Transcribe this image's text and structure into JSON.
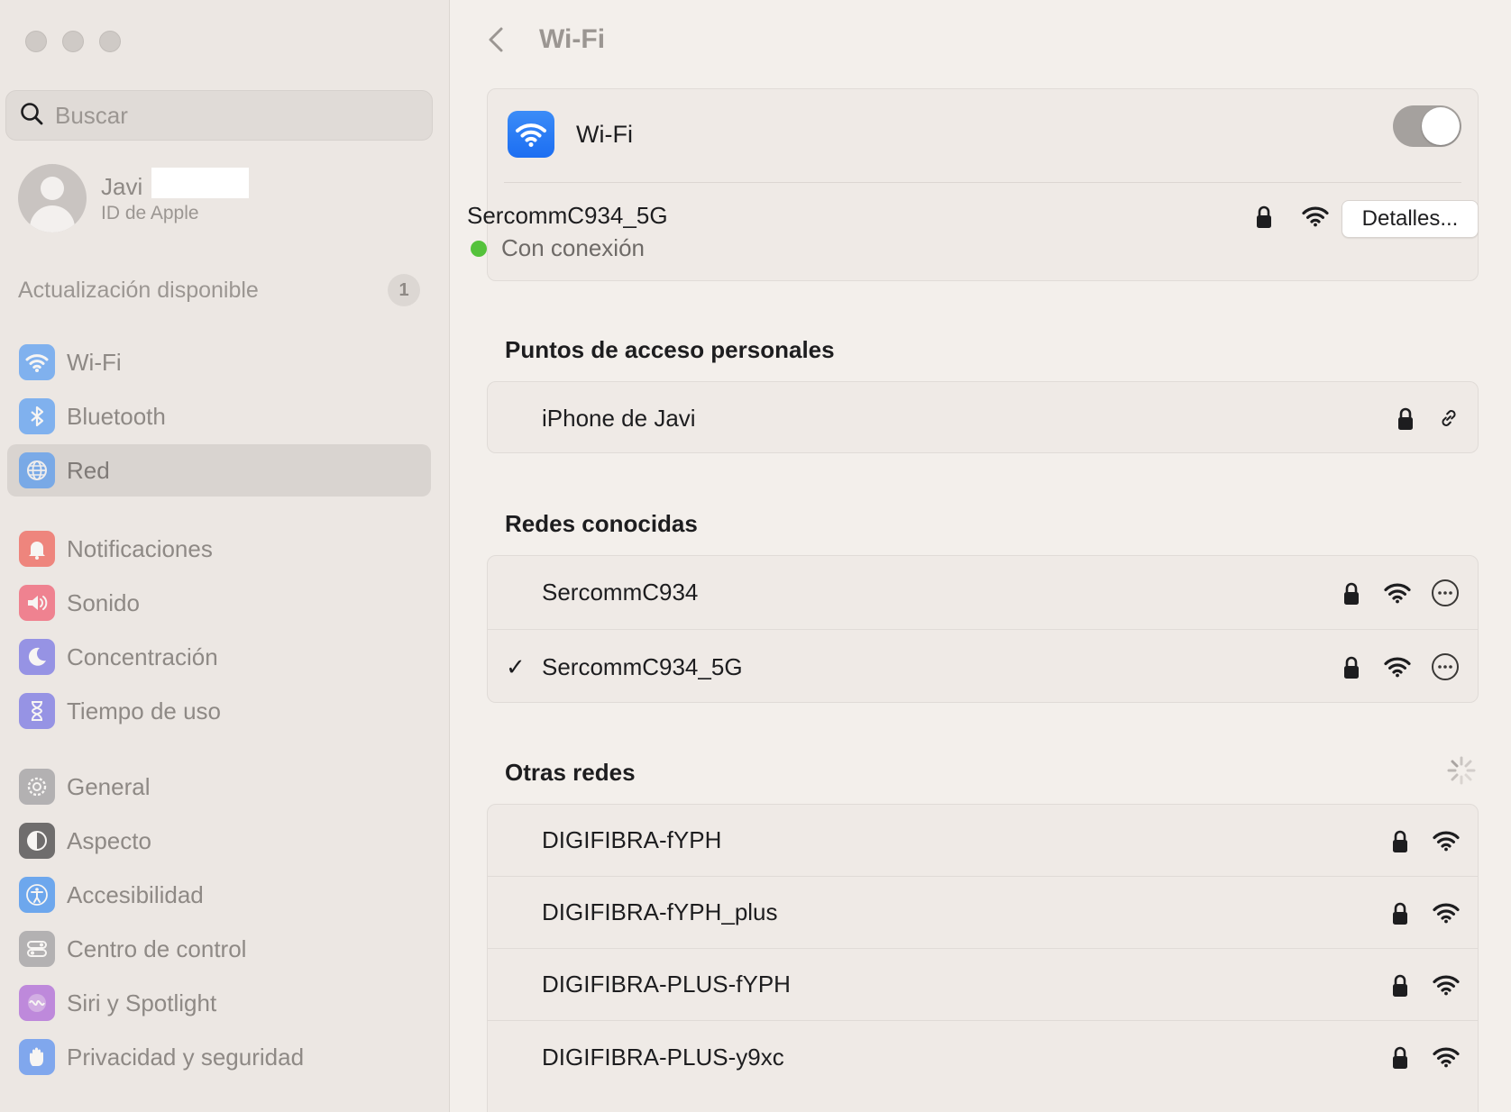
{
  "sidebar": {
    "search_placeholder": "Buscar",
    "profile": {
      "name": "Javi",
      "subtitle": "ID de Apple"
    },
    "update": {
      "label": "Actualización disponible",
      "count": "1"
    },
    "group1": [
      {
        "label": "Wi-Fi",
        "icon": "wifi-icon",
        "color": "#3a8ef6"
      },
      {
        "label": "Bluetooth",
        "icon": "bluetooth-icon",
        "color": "#3a8ef6"
      },
      {
        "label": "Red",
        "icon": "globe-icon",
        "color": "#3a8ef6",
        "active": true
      }
    ],
    "group2": [
      {
        "label": "Notificaciones",
        "icon": "bell-icon",
        "color": "#f0453a"
      },
      {
        "label": "Sonido",
        "icon": "speaker-icon",
        "color": "#f2405a"
      },
      {
        "label": "Concentración",
        "icon": "moon-icon",
        "color": "#5e5ce6"
      },
      {
        "label": "Tiempo de uso",
        "icon": "hourglass-icon",
        "color": "#5e5ce6"
      }
    ],
    "group3": [
      {
        "label": "General",
        "icon": "gear-icon",
        "color": "#8e8e93"
      },
      {
        "label": "Aspecto",
        "icon": "appearance-icon",
        "color": "#1d1d1f"
      },
      {
        "label": "Accesibilidad",
        "icon": "accessibility-icon",
        "color": "#1a7ef5"
      },
      {
        "label": "Centro de control",
        "icon": "control-center-icon",
        "color": "#8e8e93"
      },
      {
        "label": "Siri y Spotlight",
        "icon": "siri-icon",
        "color": "#a04bd6"
      },
      {
        "label": "Privacidad y seguridad",
        "icon": "hand-icon",
        "color": "#3a7ef5"
      }
    ]
  },
  "main": {
    "title": "Wi-Fi",
    "wifi_card": {
      "title": "Wi-Fi",
      "enabled": true,
      "connected_network": "SercommC934_5G",
      "status": "Con conexión",
      "status_color": "#54c23b",
      "details_label": "Detalles..."
    },
    "hotspots": {
      "heading": "Puntos de acceso personales",
      "items": [
        {
          "name": "iPhone de Javi"
        }
      ]
    },
    "known": {
      "heading": "Redes conocidas",
      "items": [
        {
          "name": "SercommC934",
          "check": ""
        },
        {
          "name": "SercommC934_5G",
          "check": "✓"
        }
      ]
    },
    "other": {
      "heading": "Otras redes",
      "items": [
        {
          "name": "DIGIFIBRA-fYPH"
        },
        {
          "name": "DIGIFIBRA-fYPH_plus"
        },
        {
          "name": "DIGIFIBRA-PLUS-fYPH"
        },
        {
          "name": "DIGIFIBRA-PLUS-y9xc"
        }
      ]
    }
  }
}
